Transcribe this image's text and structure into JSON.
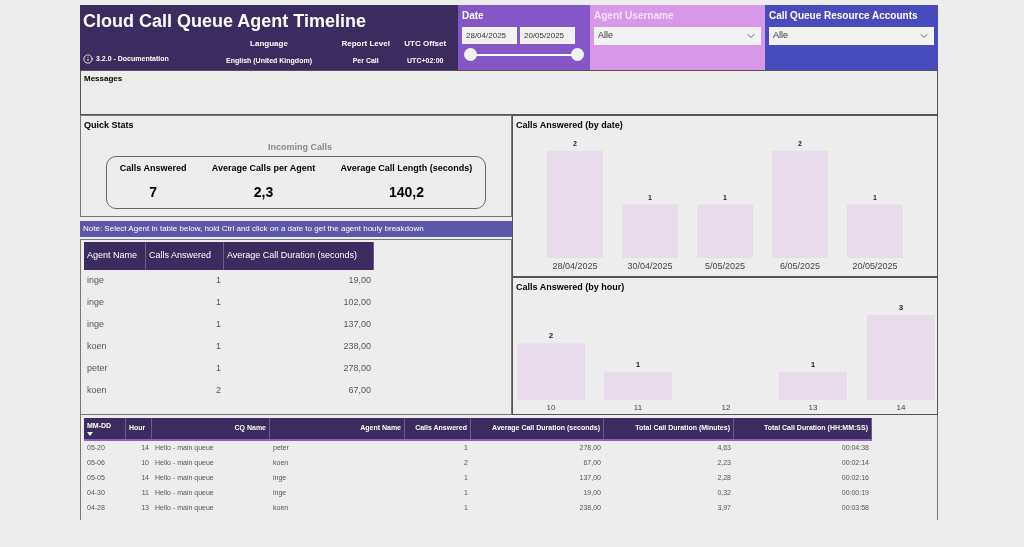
{
  "header": {
    "title": "Cloud Call Queue Agent Timeline",
    "version_link": "3.2.0 - Documentation",
    "settings": [
      {
        "label": "Language",
        "value": "English (United Kingdom)"
      },
      {
        "label": "Report Level",
        "value": "Per Call"
      },
      {
        "label": "UTC Offset",
        "value": "UTC+02:00"
      }
    ]
  },
  "date_filter": {
    "title": "Date",
    "start": "28/04/2025",
    "end": "20/05/2025",
    "slider": {
      "level": 1
    }
  },
  "agent_filter": {
    "title": "Agent Username",
    "value": "Alle"
  },
  "cq_filter": {
    "title": "Call Queue Resource Accounts",
    "value": "Alle"
  },
  "messages": {
    "title": "Messages"
  },
  "quick_stats": {
    "title": "Quick Stats",
    "subtitle": "Incoming Calls",
    "stats": [
      {
        "label": "Calls Answered",
        "value": "7"
      },
      {
        "label": "Average Calls per Agent",
        "value": "2,3"
      },
      {
        "label": "Average Call Length (seconds)",
        "value": "140,2"
      }
    ]
  },
  "note": "Note: Select Agent in table below, hold Ctrl and click on a date to get the agent houly breakdown",
  "agent_table": {
    "columns": [
      "Agent Name",
      "Calls Answered",
      "Average Call Duration (seconds)"
    ],
    "rows": [
      [
        "inge",
        "1",
        "19,00"
      ],
      [
        "inge",
        "1",
        "102,00"
      ],
      [
        "inge",
        "1",
        "137,00"
      ],
      [
        "koen",
        "1",
        "238,00"
      ],
      [
        "peter",
        "1",
        "278,00"
      ],
      [
        "koen",
        "2",
        "67,00"
      ]
    ]
  },
  "chart_by_date": {
    "title": "Calls Answered (by date)",
    "chart_data": {
      "type": "bar",
      "categories": [
        "28/04/2025",
        "30/04/2025",
        "5/05/2025",
        "6/05/2025",
        "20/05/2025"
      ],
      "values": [
        2,
        1,
        1,
        2,
        1
      ],
      "data_labels": true
    }
  },
  "chart_by_hour": {
    "title": "Calls Answered (by hour)",
    "chart_data": {
      "type": "bar",
      "categories": [
        "10",
        "11",
        "12",
        "13",
        "14"
      ],
      "values": [
        2,
        1,
        null,
        1,
        3
      ],
      "data_labels": true
    }
  },
  "detail_table": {
    "columns": [
      {
        "label": "MM-DD",
        "sorted": true
      },
      {
        "label": "Hour",
        "sorted": false
      },
      {
        "label": "CQ Name",
        "sorted": false
      },
      {
        "label": "Agent Name",
        "sorted": false
      },
      {
        "label": "Calls Answered",
        "sorted": false
      },
      {
        "label": "Average Call Duration (seconds)",
        "sorted": false
      },
      {
        "label": "Total Call Duration (Minutes)",
        "sorted": false
      },
      {
        "label": "Total Call Duration (HH:MM:SS)",
        "sorted": false
      }
    ],
    "rows": [
      [
        "05-20",
        "14",
        "Hello - main queue",
        "peter",
        "1",
        "278,00",
        "4,63",
        "00:04:38"
      ],
      [
        "05-06",
        "10",
        "Hello - main queue",
        "koen",
        "2",
        "67,00",
        "2,23",
        "00:02:14"
      ],
      [
        "05-05",
        "14",
        "Hello - main queue",
        "inge",
        "1",
        "137,00",
        "2,28",
        "00:02:16"
      ],
      [
        "04-30",
        "11",
        "Hello - main queue",
        "inge",
        "1",
        "19,00",
        "0,32",
        "00:00:19"
      ],
      [
        "04-28",
        "13",
        "Hello - main queue",
        "koen",
        "1",
        "238,00",
        "3,97",
        "00:03:58"
      ]
    ]
  }
}
